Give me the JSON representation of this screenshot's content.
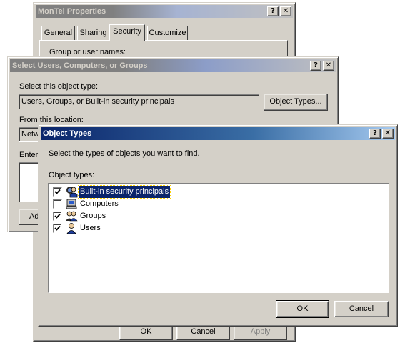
{
  "properties_window": {
    "title": "MonTel Properties",
    "tabs": [
      "General",
      "Sharing",
      "Security",
      "Customize"
    ],
    "selected_tab": "Security",
    "group_label": "Group or user names:",
    "hidden_buttons": [
      "OK",
      "Cancel",
      "Apply"
    ]
  },
  "select_window": {
    "title": "Select Users, Computers, or Groups",
    "object_type_label": "Select this object type:",
    "object_type_value": "Users, Groups, or Built-in security principals",
    "object_types_button": "Object Types...",
    "location_label": "From this location:",
    "location_value": "Netw",
    "enter_label": "Enter",
    "partial_button": "Ad"
  },
  "object_types_dialog": {
    "title": "Object Types",
    "instruction": "Select the types of objects you want to find.",
    "list_label": "Object types:",
    "items": [
      {
        "label": "Built-in security principals",
        "checked": true,
        "icon": "security-principals-icon",
        "selected": true
      },
      {
        "label": "Computers",
        "checked": false,
        "icon": "computer-icon",
        "selected": false
      },
      {
        "label": "Groups",
        "checked": true,
        "icon": "group-icon",
        "selected": false
      },
      {
        "label": "Users",
        "checked": true,
        "icon": "user-icon",
        "selected": false
      }
    ],
    "ok_label": "OK",
    "cancel_label": "Cancel"
  },
  "title_buttons": {
    "help": "?",
    "close": "✕"
  },
  "colors": {
    "face": "#d4d0c8",
    "active_title": "#0a246a",
    "selection": "#0a246a"
  }
}
